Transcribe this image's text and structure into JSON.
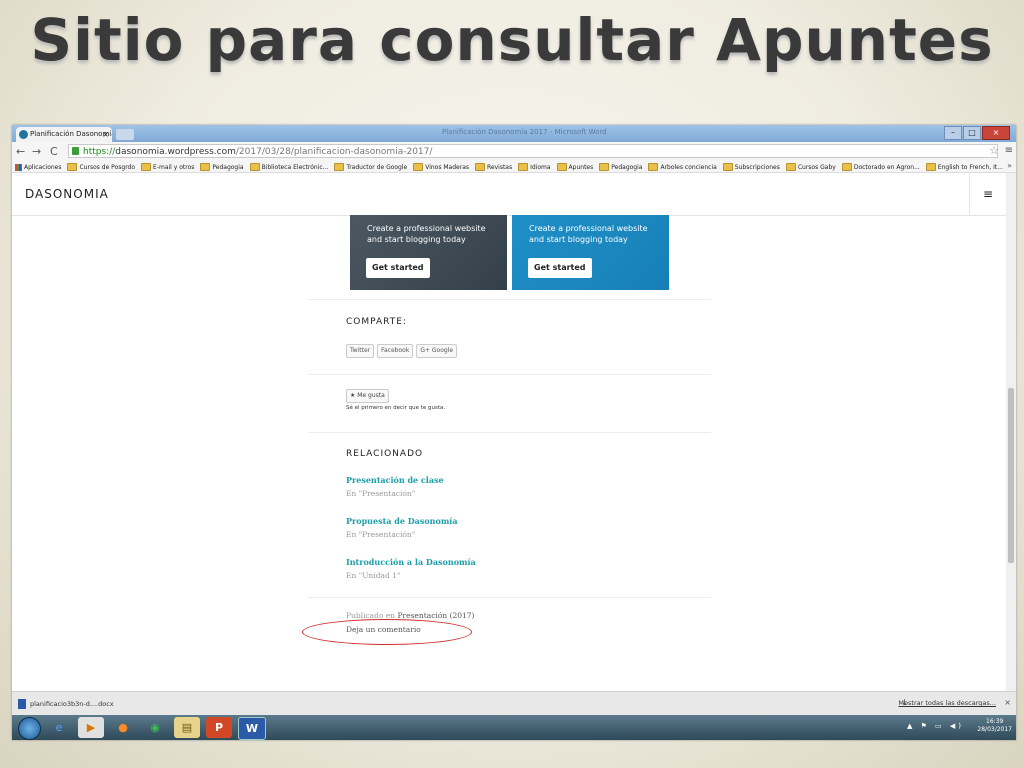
{
  "slide": {
    "title": "Sitio para consultar Apuntes"
  },
  "browser": {
    "tab_title": "Planificación Dasonomía",
    "tab_close": "×",
    "window_title": "Planificación Dasonomía 2017 - Microsoft Word",
    "controls": {
      "minimize": "–",
      "maximize": "□",
      "close": "×"
    },
    "nav": {
      "back": "←",
      "forward": "→",
      "reload": "C"
    },
    "url": {
      "scheme": "https://",
      "host": "dasonomia.wordpress.com",
      "path": "/2017/03/28/planificacion-dasonomia-2017/"
    },
    "bookmark_star": "☆",
    "menu": "≡",
    "bookmarks_more": "»",
    "bookmarks": [
      {
        "label": "Aplicaciones",
        "icon": "apps-grid-icon"
      },
      {
        "label": "Cursos de Posgrdo",
        "icon": "folder-icon"
      },
      {
        "label": "E-mail y otros",
        "icon": "folder-icon"
      },
      {
        "label": "Pedagogia",
        "icon": "folder-icon"
      },
      {
        "label": "Biblioteca Electrónic...",
        "icon": "folder-icon"
      },
      {
        "label": "Traductor de Google",
        "icon": "folder-icon"
      },
      {
        "label": "Vinos Maderas",
        "icon": "folder-icon"
      },
      {
        "label": "Revistas",
        "icon": "folder-icon"
      },
      {
        "label": "Idioma",
        "icon": "folder-icon"
      },
      {
        "label": "Apuntes",
        "icon": "folder-icon"
      },
      {
        "label": "Pedagogia",
        "icon": "folder-icon"
      },
      {
        "label": "Arboles conciencia",
        "icon": "folder-icon"
      },
      {
        "label": "Subscripciones",
        "icon": "folder-icon"
      },
      {
        "label": "Cursos Gaby",
        "icon": "folder-icon"
      },
      {
        "label": "Doctorado en Agron...",
        "icon": "folder-icon"
      },
      {
        "label": "English to French, It...",
        "icon": "folder-icon"
      }
    ]
  },
  "page": {
    "site_title": "DASONOMIA",
    "menu_icon": "≡",
    "ads": [
      {
        "text": "Create a professional website and start blogging today",
        "button": "Get started"
      },
      {
        "text": "Create a professional website and start blogging today",
        "button": "Get started"
      }
    ],
    "share": {
      "label": "COMPARTE:",
      "buttons": [
        "Twitter",
        "Facebook",
        "G+ Google"
      ]
    },
    "like": {
      "button": "★ Me gusta",
      "note": "Sé el primero en decir que te gusta."
    },
    "related": {
      "label": "RELACIONADO",
      "items": [
        {
          "title": "Presentación de clase",
          "category": "En \"Presentación\""
        },
        {
          "title": "Propuesta de Dasonomía",
          "category": "En \"Presentación\""
        },
        {
          "title": "Introducción a la Dasonomía",
          "category": "En \"Unidad 1\""
        }
      ]
    },
    "published_prefix": "Publicado en",
    "published_category": "Presentación (2017)",
    "comment_link": "Deja un comentario"
  },
  "downloads": {
    "file": "planificacio3b3n-d....docx",
    "show_all": "Mostrar todas las descargas...",
    "close": "×",
    "down_icon": "↓"
  },
  "taskbar": {
    "time": "16:39",
    "date": "28/03/2017",
    "tray_icons": "▲ ⚑ ▭ ◀)"
  }
}
